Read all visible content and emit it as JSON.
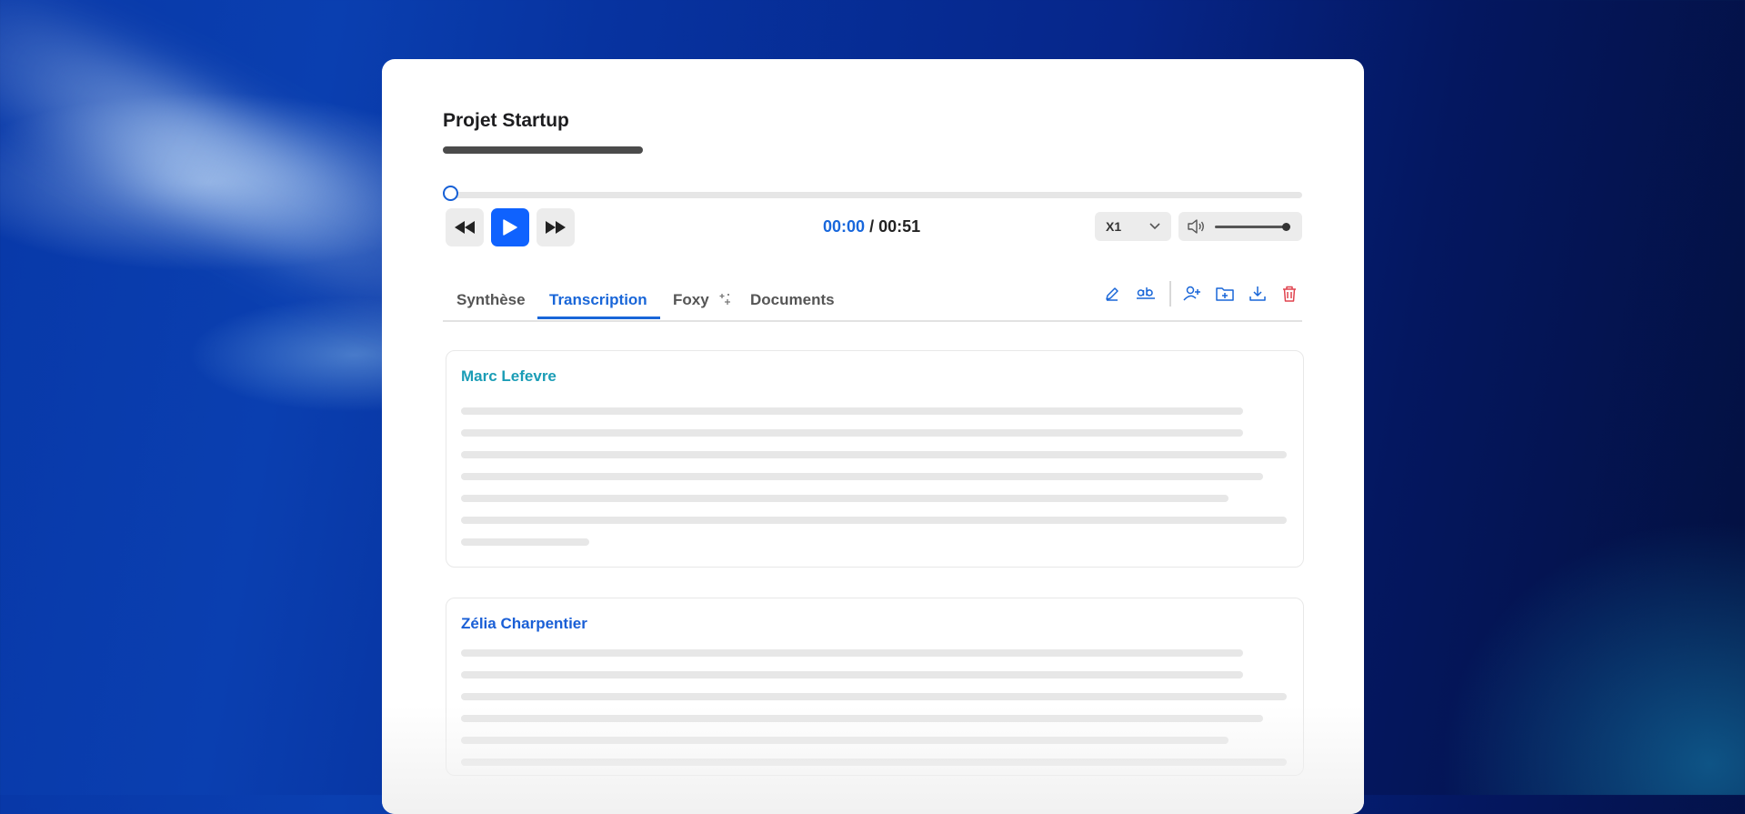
{
  "project": {
    "title": "Projet Startup"
  },
  "player": {
    "current_time": "00:00",
    "separator": "/",
    "total_time": "00:51",
    "speed": "X1",
    "progress": 0,
    "volume": 1
  },
  "tabs": [
    {
      "label": "Synthèse",
      "active": false
    },
    {
      "label": "Transcription",
      "active": true
    },
    {
      "label": "Foxy",
      "active": false
    },
    {
      "label": "Documents",
      "active": false
    }
  ],
  "toolbar_icons": [
    "pencil-icon",
    "spellcheck-icon",
    "add-user-icon",
    "add-folder-icon",
    "download-icon",
    "trash-icon"
  ],
  "transcript": [
    {
      "speaker": "Marc Lefevre",
      "color": "#1b9db6"
    },
    {
      "speaker": "Zélia Charpentier",
      "color": "#1a5fd6"
    }
  ],
  "colors": {
    "accent": "#1966d8",
    "play_button": "#0f62fe",
    "danger": "#e0434f"
  }
}
